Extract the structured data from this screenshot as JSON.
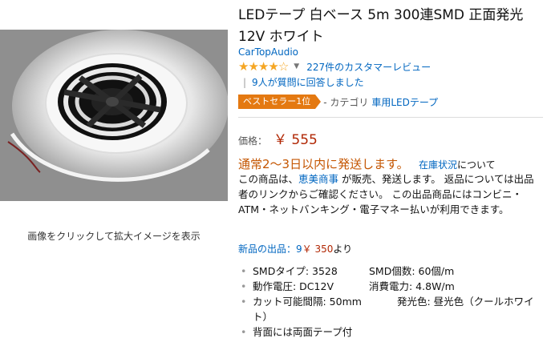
{
  "product": {
    "title": "LEDテープ 白ベース 5m 300連SMD 正面発光 12V ホワイト",
    "brand": "CarTopAudio",
    "stars_filled": 4,
    "stars_total": 5,
    "review_count_text": "227件のカスタマーレビュー",
    "qa_text": "9人が質問に回答しました",
    "bestseller_badge": "ベストセラー1位",
    "category_prefix": "- カテゴリ",
    "category_link": "車用LEDテープ"
  },
  "gallery": {
    "zoom_hint": "画像をクリックして拡大イメージを表示"
  },
  "price": {
    "label": "価格：",
    "value": "￥ 555"
  },
  "shipping": {
    "headline": "通常2～3日以内に発送します。",
    "stock_link": "在庫状況",
    "stock_suffix": "について",
    "seller_prefix": "この商品は、",
    "seller_link": "恵美商事",
    "seller_suffix": " が販売、発送します。 返品については出品者のリンクからご確認ください。 この出品商品にはコンビニ・ATM・ネットバンキング・電子マネー払いが利用できます。"
  },
  "new_offers": {
    "label": "新品の出品：9",
    "price": "￥ 350",
    "suffix": "より"
  },
  "specs": [
    {
      "a": "SMDタイプ: 3528",
      "b": "SMD個数: 60個/m"
    },
    {
      "a": "動作電圧: DC12V",
      "b": "消費電力: 4.8W/m"
    },
    {
      "a": "カット可能間隔: 50mm",
      "b": "発光色: 昼光色（クールホワイト）"
    },
    {
      "a": "背面には両面テープ付",
      "b": ""
    }
  ],
  "colors": {
    "link": "#0066c0",
    "price": "#b12704",
    "shipping": "#c45500",
    "badge": "#e47911",
    "star": "#f5a623"
  }
}
